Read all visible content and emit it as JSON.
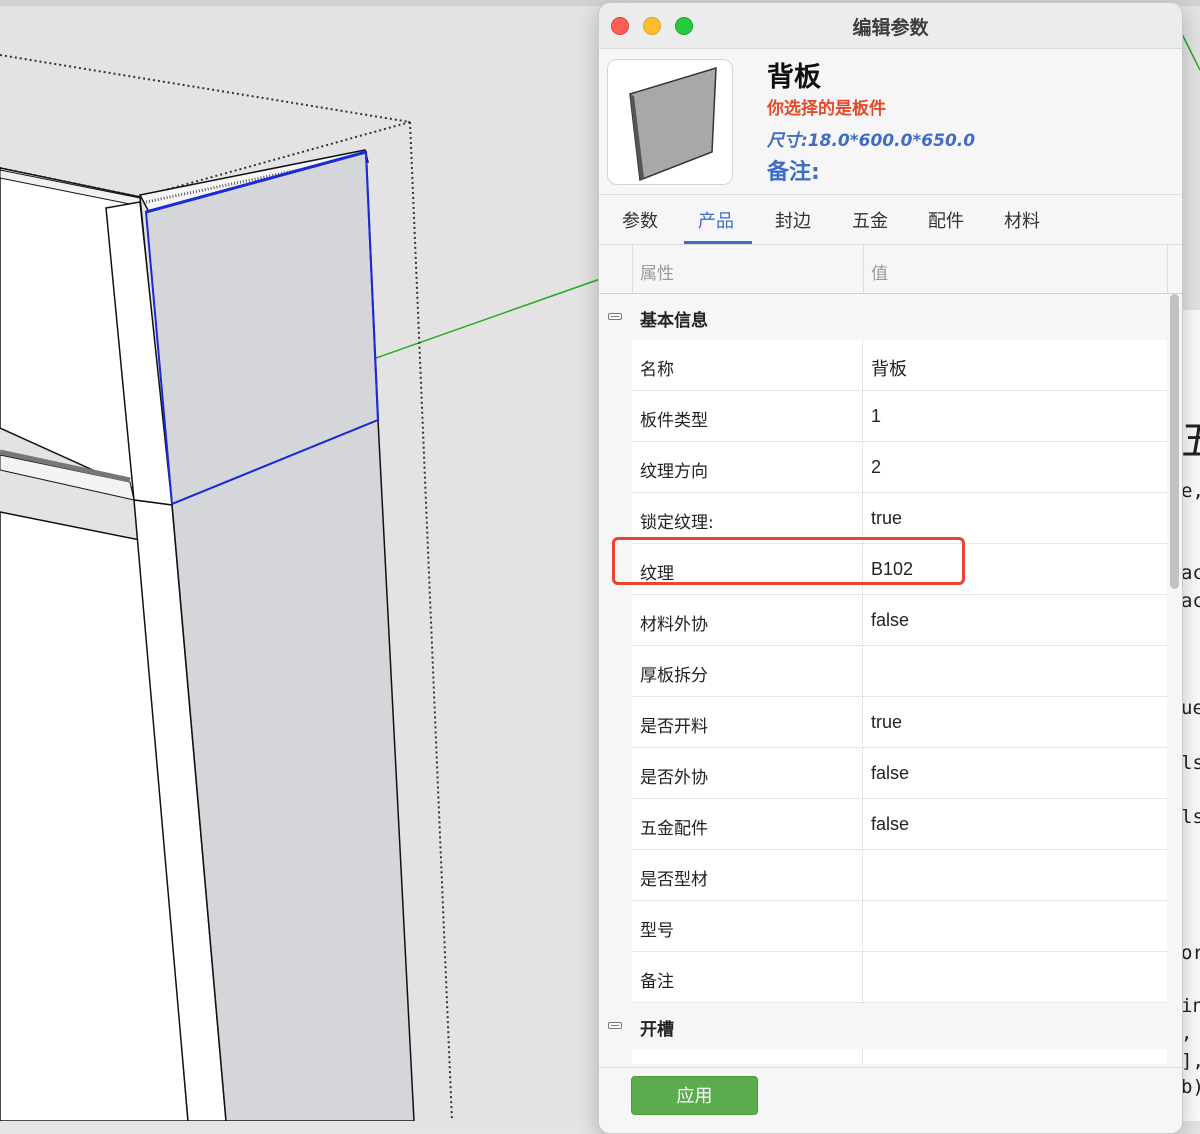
{
  "window": {
    "title": "编辑参数"
  },
  "header": {
    "part_name": "背板",
    "selection_note": "你选择的是板件",
    "size_text": "尺寸:18.0*600.0*650.0",
    "remark_label": "备注:"
  },
  "tabs": [
    {
      "label": "参数",
      "active": false
    },
    {
      "label": "产品",
      "active": true
    },
    {
      "label": "封边",
      "active": false
    },
    {
      "label": "五金",
      "active": false
    },
    {
      "label": "配件",
      "active": false
    },
    {
      "label": "材料",
      "active": false
    }
  ],
  "grid": {
    "col_attr": "属性",
    "col_value": "值",
    "category_basic": "基本信息",
    "rows": [
      {
        "name": "名称",
        "value": "背板"
      },
      {
        "name": "板件类型",
        "value": "1"
      },
      {
        "name": "纹理方向",
        "value": "2"
      },
      {
        "name": "锁定纹理:",
        "value": "true"
      },
      {
        "name": "纹理",
        "value": "B102"
      },
      {
        "name": "材料外协",
        "value": "false"
      },
      {
        "name": "厚板拆分",
        "value": ""
      },
      {
        "name": "是否开料",
        "value": "true"
      },
      {
        "name": "是否外协",
        "value": "false"
      },
      {
        "name": "五金配件",
        "value": "false"
      },
      {
        "name": "是否型材",
        "value": ""
      },
      {
        "name": "型号",
        "value": ""
      },
      {
        "name": "备注",
        "value": ""
      }
    ],
    "category_groove": "开槽"
  },
  "footer": {
    "apply_label": "应用"
  },
  "behind_window": {
    "fragments": [
      "五",
      "e,",
      "ac",
      "ac",
      "ue",
      "ls",
      "ls",
      "or",
      "in",
      ",",
      "],",
      "b)"
    ]
  },
  "colors": {
    "accent_blue": "#3f6dc6",
    "note_red": "#e14b2a",
    "highlight_red": "#e8442f",
    "apply_green": "#5cab4d",
    "selection_blue": "#1a2bd6",
    "axis_green": "#22aa22"
  }
}
